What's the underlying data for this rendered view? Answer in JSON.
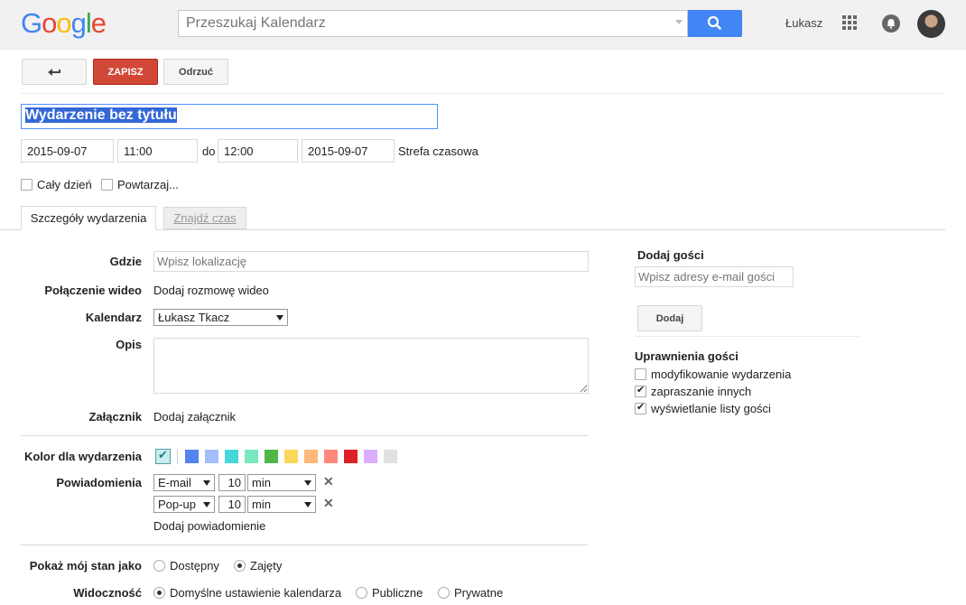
{
  "header": {
    "logo_letters": [
      {
        "ch": "G",
        "color": "#4285f4"
      },
      {
        "ch": "o",
        "color": "#ea4335"
      },
      {
        "ch": "o",
        "color": "#fbbc05"
      },
      {
        "ch": "g",
        "color": "#4285f4"
      },
      {
        "ch": "l",
        "color": "#34a853"
      },
      {
        "ch": "e",
        "color": "#ea4335"
      }
    ],
    "search_placeholder": "Przeszukaj Kalendarz",
    "user_name": "Łukasz"
  },
  "toolbar": {
    "back_icon": "back-arrow-icon",
    "save_label": "ZAPISZ",
    "discard_label": "Odrzuć"
  },
  "event": {
    "title": "Wydarzenie bez tytułu",
    "start_date": "2015-09-07",
    "start_time": "11:00",
    "to_label": "do",
    "end_time": "12:00",
    "end_date": "2015-09-07",
    "timezone_link": "Strefa czasowa",
    "all_day_label": "Cały dzień",
    "repeat_label": "Powtarzaj..."
  },
  "tabs": {
    "details": "Szczegóły wydarzenia",
    "find_time": "Znajdź czas"
  },
  "details": {
    "where_label": "Gdzie",
    "where_placeholder": "Wpisz lokalizację",
    "video_label": "Połączenie wideo",
    "video_link": "Dodaj rozmowę wideo",
    "calendar_label": "Kalendarz",
    "calendar_value": "Łukasz Tkacz",
    "description_label": "Opis",
    "attachment_label": "Załącznik",
    "attachment_link": "Dodaj załącznik",
    "color_label": "Kolor dla wydarzenia",
    "colors": [
      "#5484ed",
      "#a4bdfc",
      "#46d6db",
      "#7ae7bf",
      "#51b749",
      "#fbd75b",
      "#ffb878",
      "#ff887c",
      "#dc2127",
      "#dbadff",
      "#e1e1e1"
    ],
    "notifications_label": "Powiadomienia",
    "notifications": [
      {
        "type": "E-mail",
        "amount": "10",
        "unit": "min"
      },
      {
        "type": "Pop-up",
        "amount": "10",
        "unit": "min"
      }
    ],
    "add_notification_link": "Dodaj powiadomienie",
    "status_label": "Pokaż mój stan jako",
    "status_available": "Dostępny",
    "status_busy": "Zajęty",
    "visibility_label": "Widoczność",
    "visibility_default": "Domyślne ustawienie kalendarza",
    "visibility_public": "Publiczne",
    "visibility_private": "Prywatne"
  },
  "guests": {
    "title": "Dodaj gości",
    "email_placeholder": "Wpisz adresy e-mail gości",
    "add_button": "Dodaj",
    "permissions_title": "Uprawnienia gości",
    "permissions": [
      {
        "label": "modyfikowanie wydarzenia",
        "checked": false
      },
      {
        "label": "zapraszanie innych",
        "checked": true
      },
      {
        "label": "wyświetlanie listy gości",
        "checked": true
      }
    ]
  }
}
